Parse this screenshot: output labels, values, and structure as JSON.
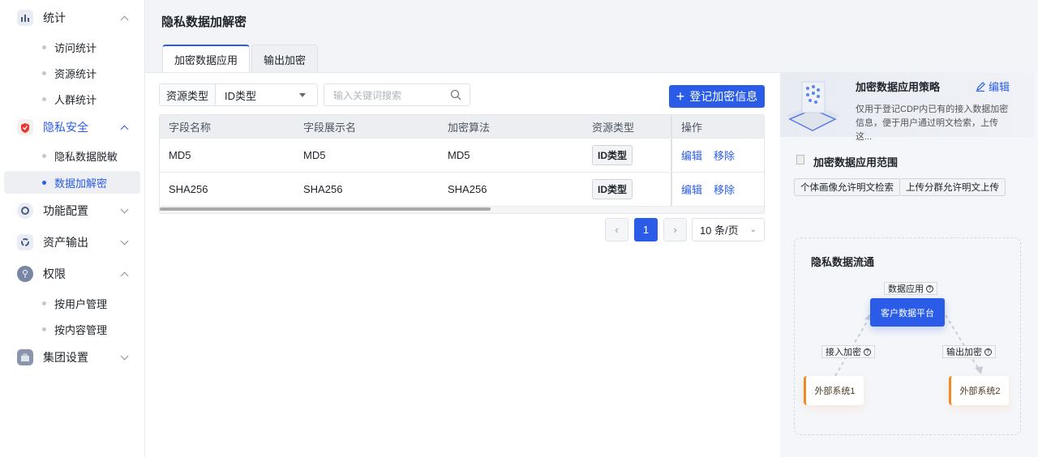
{
  "sidebar": {
    "groups": [
      {
        "label": "统计",
        "icon": "bar-chart-icon",
        "expanded": true,
        "items": [
          "访问统计",
          "资源统计",
          "人群统计"
        ]
      },
      {
        "label": "隐私安全",
        "icon": "privacy-shield-icon",
        "expanded": true,
        "active": true,
        "items": [
          "隐私数据脱敏",
          "数据加解密"
        ],
        "active_item": "数据加解密"
      },
      {
        "label": "功能配置",
        "icon": "gear-icon",
        "expanded": false
      },
      {
        "label": "资产输出",
        "icon": "asset-output-icon",
        "expanded": false
      },
      {
        "label": "权限",
        "icon": "key-icon",
        "expanded": true,
        "items": [
          "按用户管理",
          "按内容管理"
        ]
      },
      {
        "label": "集团设置",
        "icon": "briefcase-icon",
        "expanded": false
      }
    ]
  },
  "header": {
    "title": "隐私数据加解密"
  },
  "tabs": [
    {
      "label": "加密数据应用",
      "active": true
    },
    {
      "label": "输出加密",
      "active": false
    }
  ],
  "toolbar": {
    "filter_label": "资源类型",
    "filter_value": "ID类型",
    "search_placeholder": "输入关键词搜索",
    "add_button": "登记加密信息"
  },
  "table": {
    "columns": [
      "字段名称",
      "字段展示名",
      "加密算法",
      "资源类型",
      "操作"
    ],
    "rows": [
      {
        "name": "MD5",
        "display": "MD5",
        "algo": "MD5",
        "type": "ID类型"
      },
      {
        "name": "SHA256",
        "display": "SHA256",
        "algo": "SHA256",
        "type": "ID类型"
      }
    ],
    "actions": {
      "edit": "编辑",
      "remove": "移除"
    }
  },
  "pagination": {
    "current": "1",
    "page_size": "10 条/页"
  },
  "policy": {
    "title": "加密数据应用策略",
    "edit": "编辑",
    "desc": "仅用于登记CDP内已有的接入数据加密信息，便于用户通过明文检索，上传这..."
  },
  "scope": {
    "title": "加密数据应用范围",
    "chips": [
      "个体画像允许明文检索",
      "上传分群允许明文上传"
    ]
  },
  "flow": {
    "title": "隐私数据流通",
    "center": "客户数据平台",
    "top_label": "数据应用",
    "left_label": "接入加密",
    "right_label": "输出加密",
    "left_node": "外部系统1",
    "right_node": "外部系统2"
  },
  "colors": {
    "accent": "#2a5ce8",
    "warning_edge": "#f08a24"
  }
}
